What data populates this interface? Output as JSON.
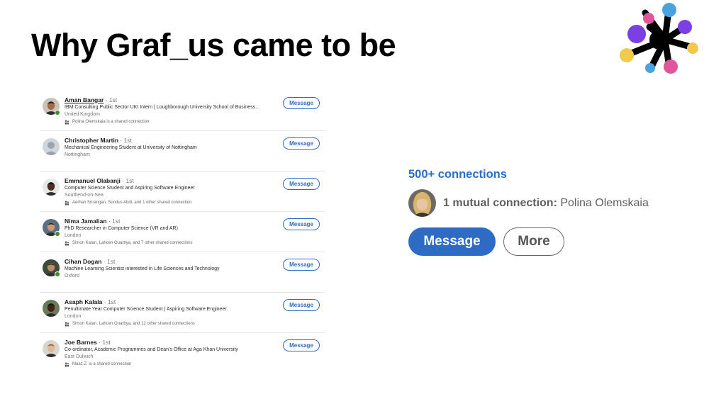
{
  "slide": {
    "title": "Why Graf_us came to be"
  },
  "connections_list": [
    {
      "name": "Aman Bangar",
      "degree": " · 1st",
      "headline": "IBM Consulting Public Sector UKI Intern | Loughborough University School of Business…",
      "location": "United Kingdom",
      "shared": "Polina Olemskaia is a shared connection",
      "online": true,
      "underlined": true,
      "avatar_skin": "#a06c48",
      "avatar_hair": "#1e1a18",
      "avatar_bg": "#c9c3b8"
    },
    {
      "name": "Christopher Martin",
      "degree": " · 1st",
      "headline": "Mechanical Engineering Student at University of Nottingham",
      "location": "Nottingham",
      "shared": "",
      "online": false,
      "underlined": false,
      "placeholder": true
    },
    {
      "name": "Emmanuel Olabanji",
      "degree": " · 1st",
      "headline": "Computer Science Student and Aspiring Software Engineer",
      "location": "Southend-on-Sea",
      "shared": "Aerhan Srirangan, Sundus Abdi, and 1 other shared connection",
      "online": false,
      "underlined": false,
      "avatar_skin": "#4a2e20",
      "avatar_hair": "#1a1210",
      "avatar_bg": "#e8e8e8"
    },
    {
      "name": "Nima Jamalian",
      "degree": " · 1st",
      "headline": "PhD Researcher in Computer Science (VR and AR)",
      "location": "London",
      "shared": "Simon Katan, Lahcen Ouarbya, and 7 other shared connections",
      "online": true,
      "underlined": false,
      "avatar_skin": "#c99a78",
      "avatar_hair": "#2a2320",
      "avatar_bg": "#5a6f86"
    },
    {
      "name": "Cihan Dogan",
      "degree": " · 1st",
      "headline": "Machine Learning Scientist interested in Life Sciences and Technology",
      "location": "Oxford",
      "shared": "",
      "online": true,
      "underlined": false,
      "avatar_skin": "#b98c68",
      "avatar_hair": "#2b2420",
      "avatar_bg": "#3e4a3a"
    },
    {
      "name": "Asaph Kalala",
      "degree": " · 1st",
      "headline": "Penultimate Year Computer Science Student | Aspiring Software Engineer",
      "location": "London",
      "shared": "Simon Katan, Lahcen Ouarbya, and 12 other shared connections",
      "online": false,
      "underlined": false,
      "avatar_skin": "#3b2619",
      "avatar_hair": "#1a1210",
      "avatar_bg": "#6b7a5a"
    },
    {
      "name": "Joe Barnes",
      "degree": " · 1st",
      "headline": "Co-ordinator, Academic Programmes and Dean's Office at Aga Khan University",
      "location": "East Dulwich",
      "shared": "Maaz Z. is a shared connection",
      "online": false,
      "underlined": false,
      "avatar_skin": "#e0b99a",
      "avatar_hair": "#8a6a4a",
      "avatar_bg": "#d9d6cf"
    }
  ],
  "connection_button_label": "Message",
  "profile": {
    "connections_count": "500+ connections",
    "mutual_label": "1 mutual connection:",
    "mutual_name": " Polina Olemskaia",
    "message_label": "Message",
    "more_label": "More"
  },
  "colors": {
    "accent": "#2d6bc4",
    "online": "#3d8a2f",
    "logo_purple": "#7b3fe4",
    "logo_blue": "#4aa3df",
    "logo_pink": "#e0559b",
    "logo_yellow": "#f3c94b"
  }
}
